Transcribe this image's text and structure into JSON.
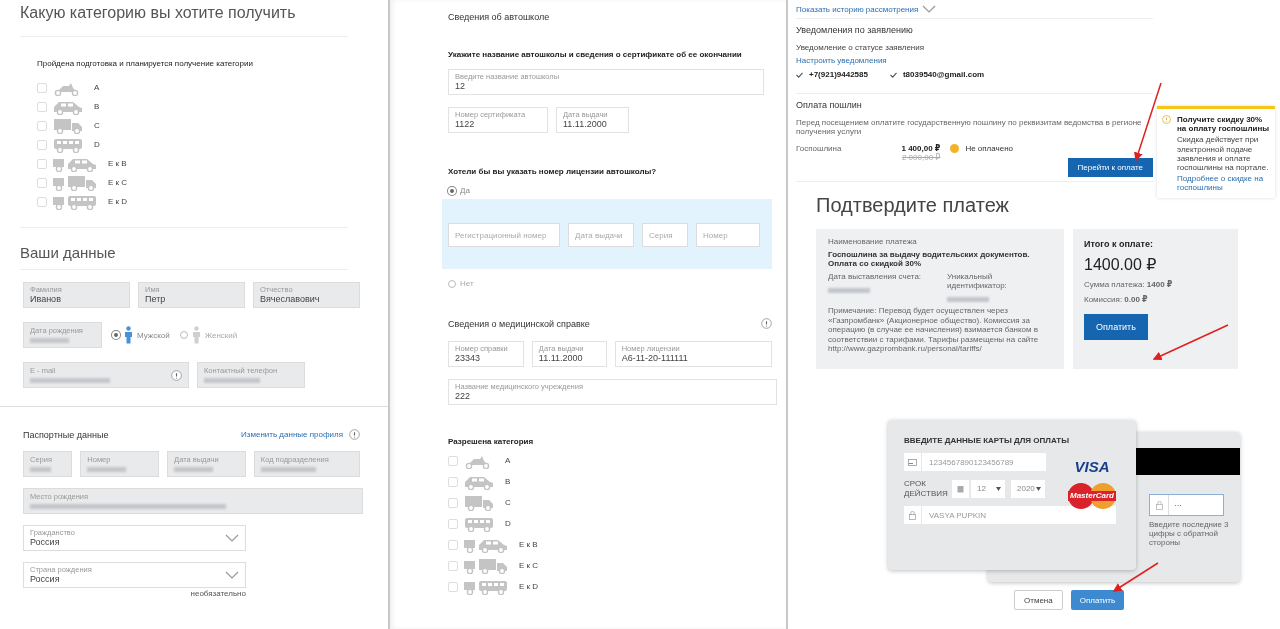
{
  "category_section": {
    "title": "Какую категорию вы хотите получить",
    "subtitle": "Пройдена подготовка и планируется получение категории",
    "categories": [
      {
        "kind": "moto",
        "label": "A",
        "checked": false
      },
      {
        "kind": "car",
        "label": "B",
        "checked": false
      },
      {
        "kind": "truck",
        "label": "C",
        "checked": false
      },
      {
        "kind": "bus",
        "label": "D",
        "checked": false
      },
      {
        "kind": "trailer_car",
        "label": "E к B",
        "checked": false
      },
      {
        "kind": "trailer_truck",
        "label": "E к C",
        "checked": false
      },
      {
        "kind": "trailer_bus",
        "label": "E к D",
        "checked": false
      }
    ]
  },
  "personal": {
    "title": "Ваши данные",
    "name_fields": [
      {
        "label": "Фамилия",
        "value": "Иванов"
      },
      {
        "label": "Имя",
        "value": "Петр"
      },
      {
        "label": "Отчество",
        "value": "Вячеславович"
      }
    ],
    "birth_date": {
      "label": "Дата рождения",
      "redacted": true
    },
    "gender": [
      {
        "label": "Мужской",
        "selected": true
      },
      {
        "label": "Женский",
        "selected": false
      }
    ],
    "email": {
      "label": "E - mail",
      "redacted": true
    },
    "phone": {
      "label": "Контактный телефон",
      "redacted": true
    }
  },
  "passport": {
    "title": "Паспортные данные",
    "edit_link": "Изменить данные профиля",
    "fields": [
      {
        "label": "Серия",
        "redacted": true
      },
      {
        "label": "Номер",
        "redacted": true
      },
      {
        "label": "Дата выдачи",
        "redacted": true
      },
      {
        "label": "Код подразделения",
        "redacted": true
      }
    ],
    "birth_place": {
      "label": "Место рождения",
      "redacted": true
    },
    "selects": [
      {
        "label": "Гражданство",
        "value": "Россия"
      },
      {
        "label": "Страна рождения",
        "value": "Россия",
        "note": "необязательно"
      }
    ]
  },
  "school": {
    "title": "Сведения об автошколе",
    "prompt": "Укажите название автошколы и сведения о сертификате об ее окончании",
    "name_field": {
      "label": "Введите название автошколы",
      "value": "12"
    },
    "certificate_fields": [
      {
        "label": "Номер сертификата",
        "value": "1122"
      },
      {
        "label": "Дата выдачи",
        "value": "11.11.2000"
      }
    ],
    "license_question": "Хотели бы вы указать номер лицензии автошколы?",
    "license_options": [
      {
        "label": "Да",
        "selected": true
      },
      {
        "label": "Нет",
        "selected": false
      }
    ],
    "license_fields": [
      {
        "placeholder": "Регистрационный номер"
      },
      {
        "placeholder": "Дата выдачи"
      },
      {
        "placeholder": "Серия"
      },
      {
        "placeholder": "Номер"
      }
    ]
  },
  "medical": {
    "title": "Сведения о медицинской справке",
    "fields": [
      {
        "label": "Номер справки",
        "value": "23343"
      },
      {
        "label": "Дата выдачи",
        "value": "11.11.2000"
      },
      {
        "label": "Номер лицензии",
        "value": "А6-11-20-111111"
      }
    ],
    "institution_field": {
      "label": "Название медицинского учреждения",
      "value": "222"
    }
  },
  "allowed": {
    "title": "Разрешена категория",
    "categories": [
      {
        "kind": "moto",
        "label": "A",
        "checked": false
      },
      {
        "kind": "car",
        "label": "B",
        "checked": false
      },
      {
        "kind": "truck",
        "label": "C",
        "checked": false
      },
      {
        "kind": "bus",
        "label": "D",
        "checked": false
      },
      {
        "kind": "trailer_car",
        "label": "E к B",
        "checked": false
      },
      {
        "kind": "trailer_truck",
        "label": "E к C",
        "checked": false
      },
      {
        "kind": "trailer_bus",
        "label": "E к D",
        "checked": false
      }
    ]
  },
  "application": {
    "history_link": "Показать историю рассмотрения",
    "notifications": {
      "title": "Уведомления по заявлению",
      "subtitle": "Уведомление о статусе заявления",
      "settings_link": "Настроить уведомления",
      "channels": [
        {
          "label": "+7(921)9442585",
          "checked": true
        },
        {
          "label": "t8039540@gmail.com",
          "checked": true
        }
      ]
    },
    "fees": {
      "title": "Оплата пошлин",
      "description": "Перед посещением оплатите государственную пошлину по реквизитам ведомства в регионе получения услуги",
      "rows": [
        {
          "name": "Госпошлина",
          "amount": "1 400,00 ₽",
          "old_amount": "2 000,00 ₽",
          "status": "Не оплачено"
        }
      ],
      "pay_button": "Перейти к оплате"
    },
    "discount_card": {
      "title": "Получите скидку 30% на оплату госпошлины",
      "text": "Скидка действует при электронной подаче заявления и оплате госпошлины на портале.",
      "link": "Подробнее о скидке на госпошлины"
    }
  },
  "payment": {
    "title": "Подтвердите платеж",
    "details": {
      "name_label": "Наименование платежа",
      "name": "Госпошлина за выдачу водительских документов. Оплата со скидкой 30%",
      "date": {
        "label": "Дата выставления счета:",
        "redacted": true
      },
      "id": {
        "label": "Уникальный идентификатор:",
        "redacted": true
      },
      "note": "Примечание: Перевод будет осуществлен через «Газпромбанк» (Акционерное общество). Комиссия за операцию (в случае ее начисления) взимается банком в соответствии с тарифами. Тарифы размещены на сайте http://www.gazprombank.ru/personal/tariffs/"
    },
    "summary": {
      "title": "Итого к оплате:",
      "total": "1400.00 ₽",
      "sum": "Сумма платежа: **1400 ₽**",
      "commission": "Комиссия: **0.00 ₽**",
      "pay_button": "Оплатить"
    }
  },
  "card_form": {
    "title": "ВВЕДИТЕ ДАННЫЕ КАРТЫ ДЛЯ ОПЛАТЫ",
    "card_number_placeholder": "1234567890123456789",
    "expiry_label": "СРОК ДЕЙСТВИЯ",
    "month": "12",
    "year": "2020",
    "holder_placeholder": "VASYA PUPKIN",
    "logos": [
      {
        "kind": "visa",
        "text": "VISA"
      },
      {
        "kind": "mastercard",
        "text": "MasterCard"
      }
    ],
    "cvv": "···",
    "cvv_hint": "Введите последние 3 цифры с обратной стороны",
    "cancel_button": "Отмена",
    "pay_button": "Оплатить"
  }
}
